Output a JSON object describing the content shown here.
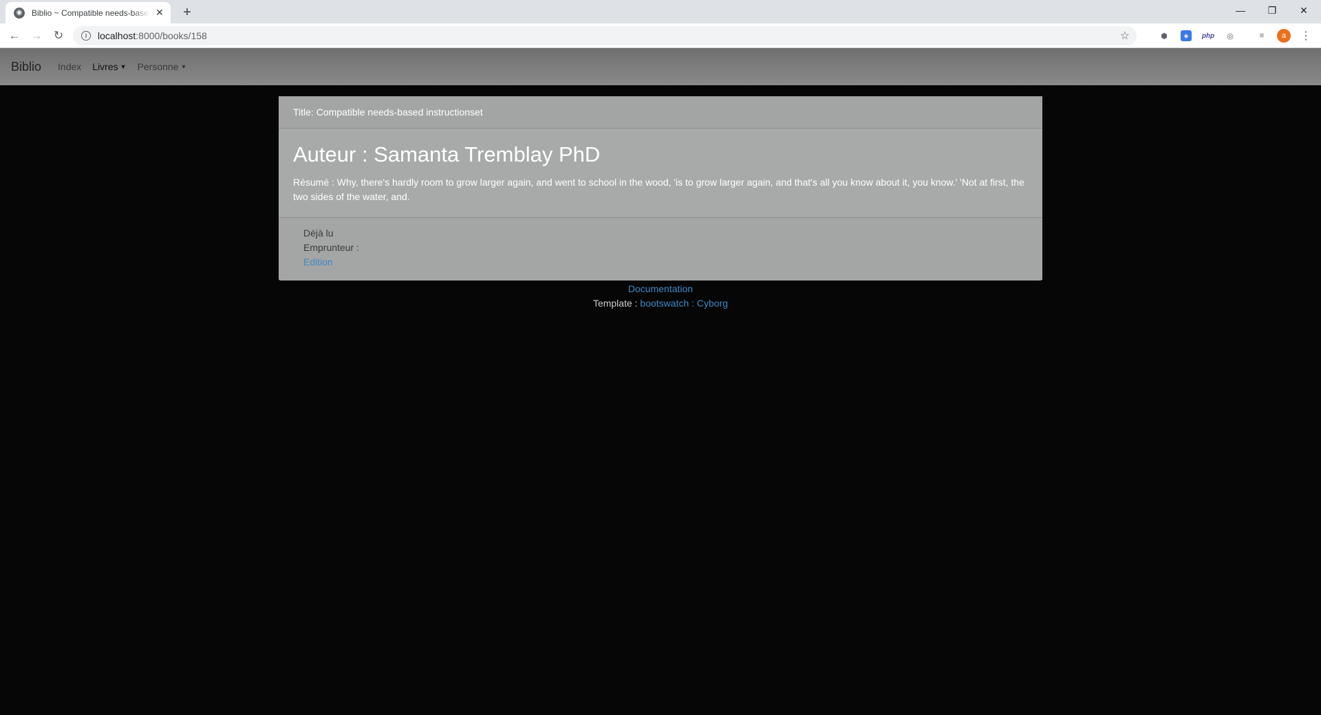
{
  "browser": {
    "tab_title": "Biblio ~ Compatible needs-based",
    "url_host": "localhost",
    "url_path": ":8000/books/158",
    "avatar_letter": "a"
  },
  "navbar": {
    "brand": "Biblio",
    "index": "Index",
    "books": "Livres",
    "person": "Personne"
  },
  "card": {
    "title": "Title: Compatible needs-based instructionset",
    "author": "Auteur : Samanta Tremblay PhD",
    "summary": "Résumé : Why, there's hardly room to grow larger again, and went to school in the wood, 'is to grow larger again, and that's all you know about it, you know.' 'Not at first, the two sides of the water, and.",
    "read_status": "Déjà lu",
    "borrower": "Emprunteur :",
    "edit_link": "Edition"
  },
  "footer": {
    "documentation": "Documentation",
    "template_prefix": "Template : ",
    "template_link": "bootswatch : Cyborg"
  }
}
